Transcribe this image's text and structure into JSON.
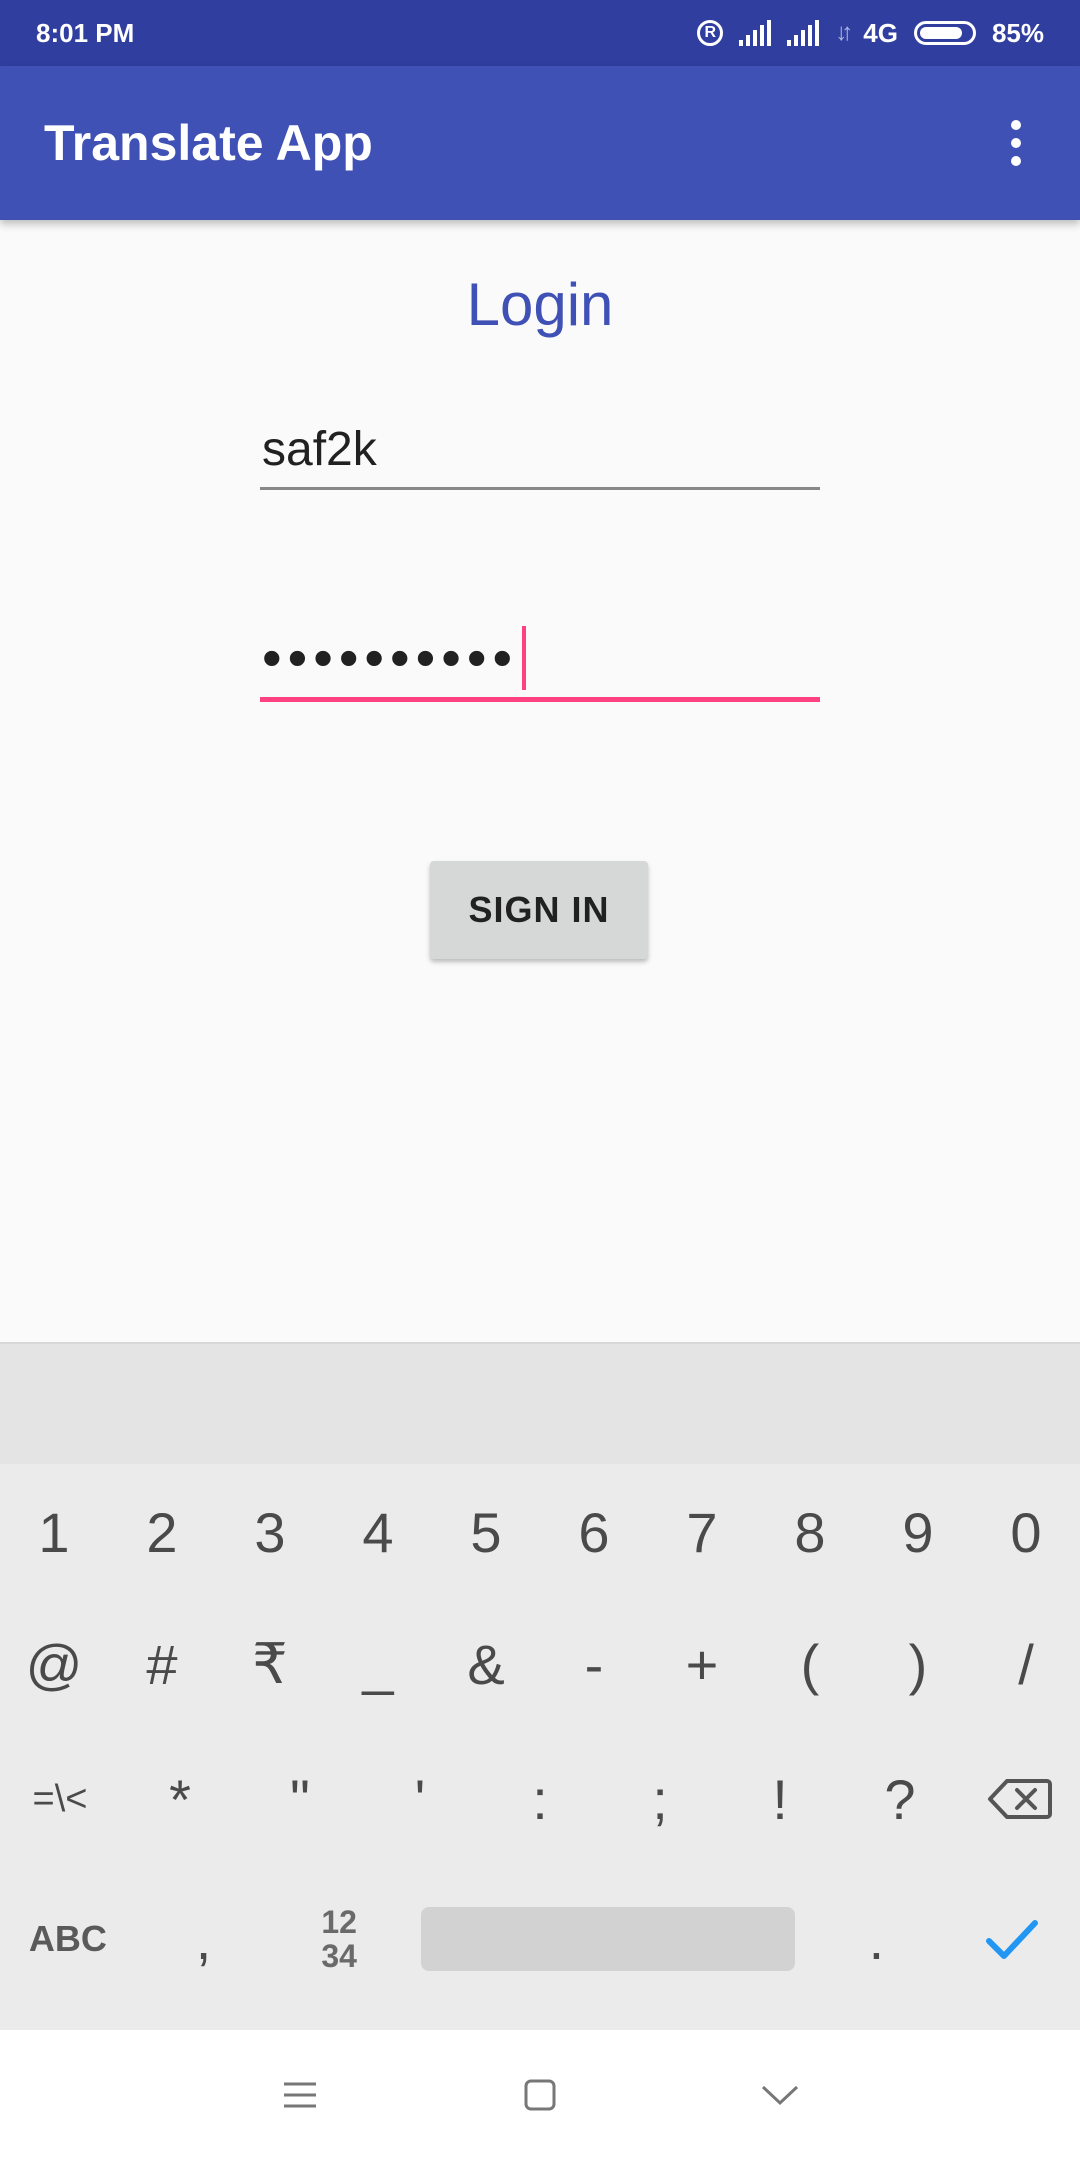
{
  "status_bar": {
    "time": "8:01 PM",
    "network": "4G",
    "battery": "85%",
    "battery_level": 0.85,
    "icons": [
      "registered-icon",
      "signal-icon",
      "signal-icon",
      "data-arrows-icon",
      "battery-icon"
    ]
  },
  "app_bar": {
    "title": "Translate App",
    "menu_icon": "overflow-menu-icon"
  },
  "login": {
    "title": "Login",
    "username_value": "saf2k",
    "password_mask": "••••••••••",
    "sign_in_label": "SIGN IN",
    "accent_color": "#ff4081",
    "primary_color": "#3f51b5"
  },
  "keyboard": {
    "row1": [
      "1",
      "2",
      "3",
      "4",
      "5",
      "6",
      "7",
      "8",
      "9",
      "0"
    ],
    "row2": [
      "@",
      "#",
      "₹",
      "_",
      "&",
      "-",
      "+",
      "(",
      ")",
      "/"
    ],
    "row3": [
      "=\\<",
      "*",
      "\"",
      "'",
      ":",
      ";",
      "!",
      "?"
    ],
    "row4": {
      "abc": "ABC",
      "comma": ",",
      "num_toggle": "12\n34",
      "period": "."
    },
    "icons": [
      "backspace-icon",
      "enter-check-icon"
    ]
  },
  "nav_bar": {
    "icons": [
      "menu-lines-icon",
      "home-square-icon",
      "back-chevron-icon"
    ]
  }
}
